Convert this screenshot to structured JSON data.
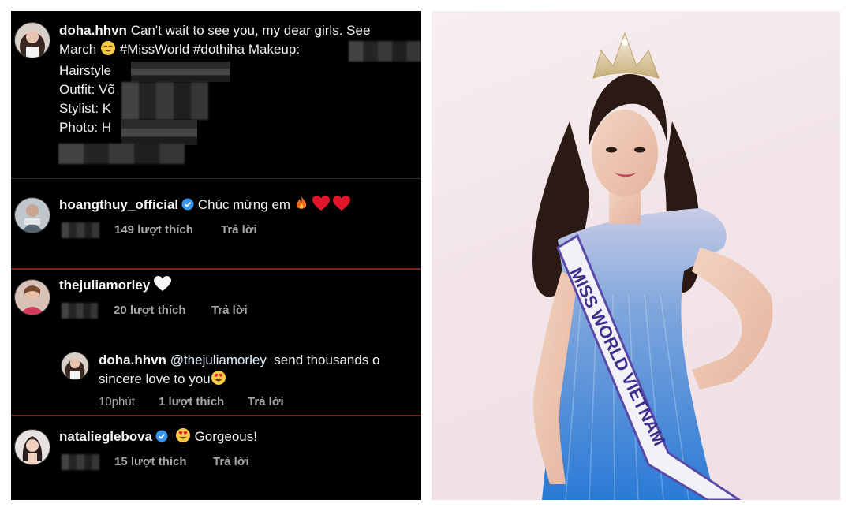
{
  "post": {
    "username": "doha.hhvn",
    "caption_line1": "Can't wait to see you, my dear girls. See",
    "caption_line2_a": "March",
    "caption_line2_b": "#MissWorld #dothiha Makeup:",
    "caption_line3": "Hairstyle",
    "caption_line4": "Outfit: Võ",
    "caption_line5": "Stylist: K",
    "caption_line6": "Photo: H"
  },
  "comments": [
    {
      "username": "hoangthuy_official",
      "text": "Chúc mừng em",
      "likes": "149 lượt thích",
      "reply": "Trả lời"
    },
    {
      "username": "thejuliamorley",
      "likes": "20 lượt thích",
      "reply": "Trả lời"
    },
    {
      "username": "doha.hhvn",
      "mention": "@thejuliamorley",
      "text_line1": "send thousands o",
      "text_line2": "sincere love to you",
      "time": "10phút",
      "likes": "1 lượt thích",
      "reply": "Trả lời"
    },
    {
      "username": "natalieglebova",
      "text": "Gorgeous!",
      "likes": "15 lượt thích",
      "reply": "Trả lời"
    }
  ],
  "photo": {
    "sash_text": "MISS WORLD VIETNAM"
  },
  "colors": {
    "mention": "#e0f0ff",
    "verified": "#3897f0",
    "divider_red": "#7a2222"
  }
}
